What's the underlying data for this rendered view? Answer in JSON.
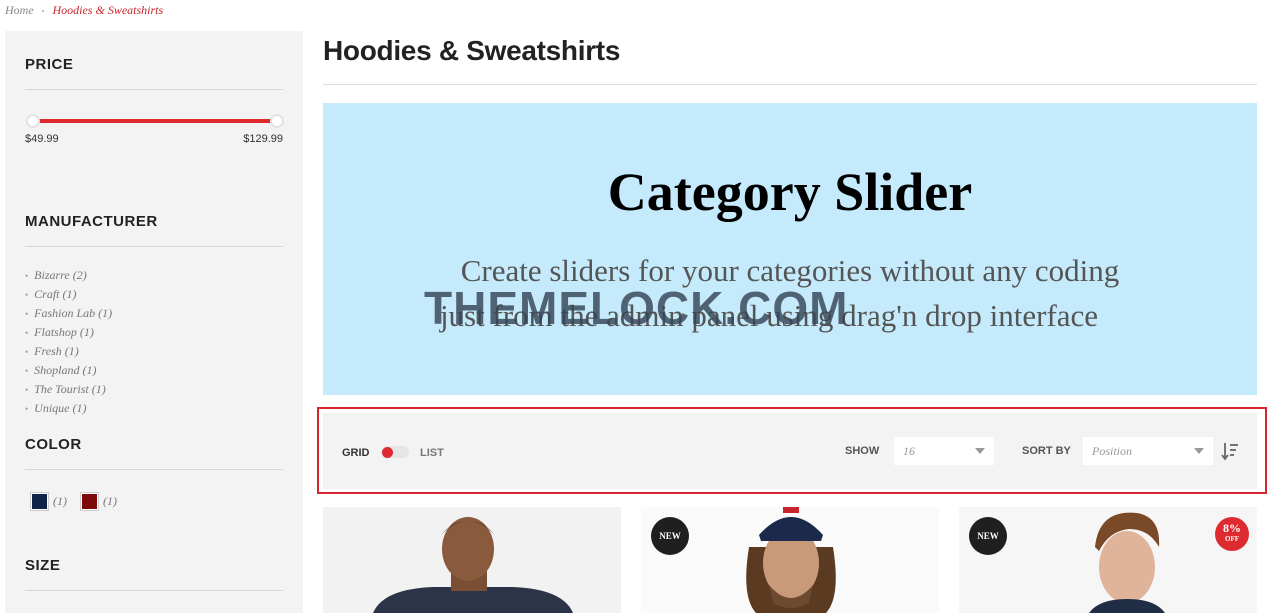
{
  "breadcrumb": {
    "home": "Home",
    "separator": "•",
    "current": "Hoodies & Sweatshirts"
  },
  "sidebar": {
    "price": {
      "title": "PRICE",
      "min": "$49.99",
      "max": "$129.99"
    },
    "manufacturer": {
      "title": "MANUFACTURER",
      "items": [
        {
          "label": "Bizarre (2)"
        },
        {
          "label": "Craft (1)"
        },
        {
          "label": "Fashion Lab (1)"
        },
        {
          "label": "Flatshop (1)"
        },
        {
          "label": "Fresh (1)"
        },
        {
          "label": "Shopland (1)"
        },
        {
          "label": "The Tourist (1)"
        },
        {
          "label": "Unique (1)"
        }
      ]
    },
    "color": {
      "title": "COLOR",
      "swatches": [
        {
          "color": "#0f2447",
          "count": "(1)"
        },
        {
          "color": "#7d0a0a",
          "count": "(1)"
        }
      ]
    },
    "size": {
      "title": "SIZE"
    }
  },
  "main": {
    "title": "Hoodies & Sweatshirts",
    "banner": {
      "title": "Category Slider",
      "line1": "Create sliders for your categories without any coding",
      "line2": "just from the admin panel        using drag'n drop interface",
      "watermark": "THEMELOCK.COM",
      "background": "#c4eafb"
    },
    "toolbar": {
      "grid_label": "GRID",
      "list_label": "LIST",
      "show_label": "SHOW",
      "show_value": "16",
      "sort_label": "SORT BY",
      "sort_value": "Position",
      "highlight_color": "#d7262d"
    },
    "products": [
      {
        "badge": ""
      },
      {
        "badge": "NEW"
      },
      {
        "badge": "NEW",
        "discount_pct": "8%",
        "discount_label": "OFF"
      }
    ]
  },
  "colors": {
    "accent": "#dd2a2f",
    "sidebar_bg": "#f3f3f3"
  }
}
